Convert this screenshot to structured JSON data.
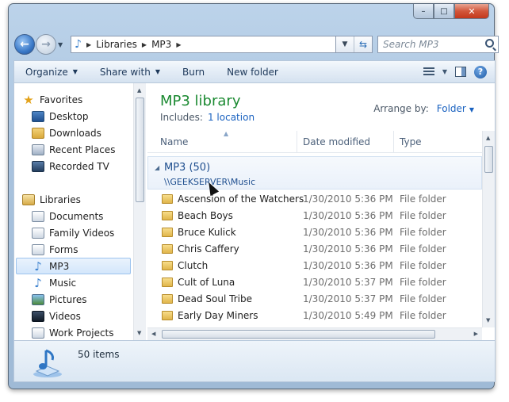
{
  "window": {
    "caption_buttons": {
      "minimize": "–",
      "maximize": "□",
      "close": "✕"
    }
  },
  "nav": {
    "breadcrumb": [
      "Libraries",
      "MP3"
    ],
    "search_placeholder": "Search MP3"
  },
  "toolbar": {
    "organize": "Organize",
    "share_with": "Share with",
    "burn": "Burn",
    "new_folder": "New folder"
  },
  "sidebar": {
    "favorites_label": "Favorites",
    "favorites": [
      {
        "label": "Desktop",
        "icon": "desktop-icon"
      },
      {
        "label": "Downloads",
        "icon": "downloads-icon"
      },
      {
        "label": "Recent Places",
        "icon": "recent-places-icon"
      },
      {
        "label": "Recorded TV",
        "icon": "recorded-tv-icon"
      }
    ],
    "libraries_label": "Libraries",
    "libraries": [
      {
        "label": "Documents",
        "icon": "documents-icon"
      },
      {
        "label": "Family Videos",
        "icon": "library-icon"
      },
      {
        "label": "Forms",
        "icon": "library-icon"
      },
      {
        "label": "MP3",
        "icon": "music-note-icon",
        "selected": true
      },
      {
        "label": "Music",
        "icon": "music-note-icon"
      },
      {
        "label": "Pictures",
        "icon": "pictures-icon"
      },
      {
        "label": "Videos",
        "icon": "videos-icon"
      },
      {
        "label": "Work Projects",
        "icon": "library-icon"
      }
    ]
  },
  "library": {
    "title": "MP3 library",
    "includes_label": "Includes:",
    "includes_link": "1 location",
    "arrange_label": "Arrange by:",
    "arrange_value": "Folder"
  },
  "columns": {
    "name": "Name",
    "date": "Date modified",
    "type": "Type"
  },
  "group": {
    "title": "MP3 (50)",
    "path": "\\\\GEEKSERVER\\Music"
  },
  "rows": [
    {
      "name": "Ascension of the Watchers",
      "date": "1/30/2010 5:36 PM",
      "type": "File folder"
    },
    {
      "name": "Beach Boys",
      "date": "1/30/2010 5:36 PM",
      "type": "File folder"
    },
    {
      "name": "Bruce Kulick",
      "date": "1/30/2010 5:36 PM",
      "type": "File folder"
    },
    {
      "name": "Chris Caffery",
      "date": "1/30/2010 5:36 PM",
      "type": "File folder"
    },
    {
      "name": "Clutch",
      "date": "1/30/2010 5:36 PM",
      "type": "File folder"
    },
    {
      "name": "Cult of Luna",
      "date": "1/30/2010 5:37 PM",
      "type": "File folder"
    },
    {
      "name": "Dead Soul Tribe",
      "date": "1/30/2010 5:37 PM",
      "type": "File folder"
    },
    {
      "name": "Early Day Miners",
      "date": "1/30/2010 5:49 PM",
      "type": "File folder"
    }
  ],
  "details": {
    "count": "50 items"
  }
}
